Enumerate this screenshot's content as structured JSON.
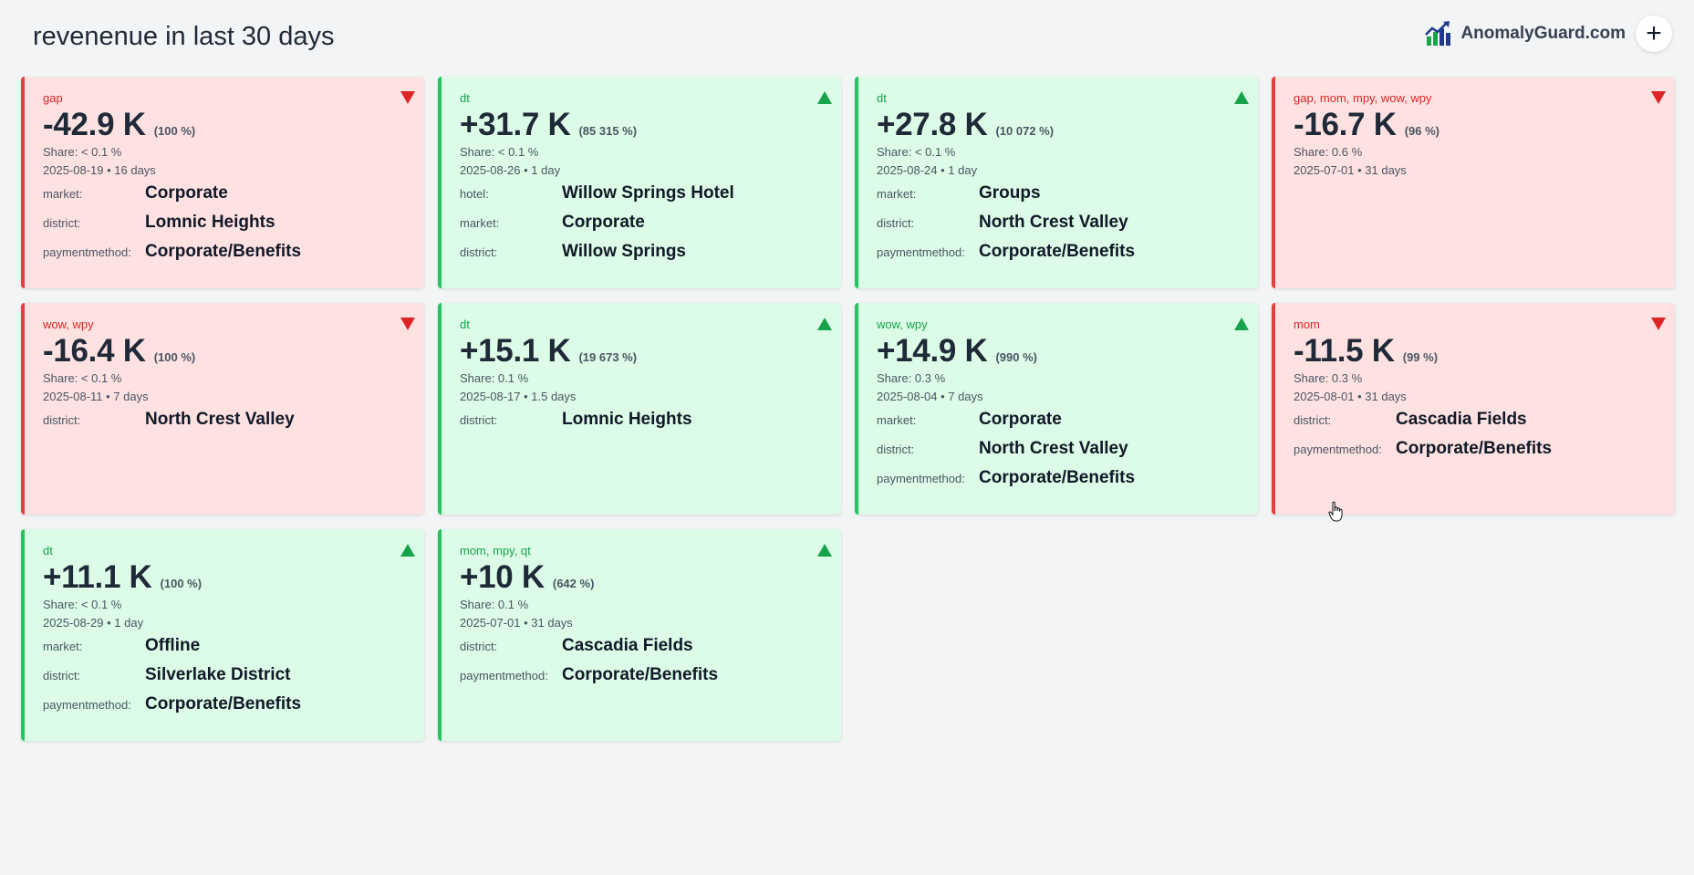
{
  "header": {
    "title": "revenenue in last 30 days",
    "brand": "AnomalyGuard.com",
    "add_label": "+"
  },
  "cards": [
    {
      "dir": "down",
      "tags": "gap",
      "value": "-42.9 K",
      "pct": "(100 %)",
      "share": "Share: < 0.1 %",
      "date": "2025-08-19 • 16 days",
      "dims": [
        {
          "k": "market:",
          "v": "Corporate"
        },
        {
          "k": "district:",
          "v": "Lomnic Heights"
        },
        {
          "k": "paymentmethod:",
          "v": "Corporate/Benefits"
        }
      ]
    },
    {
      "dir": "up",
      "tags": "dt",
      "value": "+31.7 K",
      "pct": "(85 315 %)",
      "share": "Share: < 0.1 %",
      "date": "2025-08-26 • 1 day",
      "dims": [
        {
          "k": "hotel:",
          "v": "Willow Springs Hotel"
        },
        {
          "k": "market:",
          "v": "Corporate"
        },
        {
          "k": "district:",
          "v": "Willow Springs"
        }
      ]
    },
    {
      "dir": "up",
      "tags": "dt",
      "value": "+27.8 K",
      "pct": "(10 072 %)",
      "share": "Share: < 0.1 %",
      "date": "2025-08-24 • 1 day",
      "dims": [
        {
          "k": "market:",
          "v": "Groups"
        },
        {
          "k": "district:",
          "v": "North Crest Valley"
        },
        {
          "k": "paymentmethod:",
          "v": "Corporate/Benefits"
        }
      ]
    },
    {
      "dir": "down",
      "tags": "gap, mom, mpy, wow, wpy",
      "value": "-16.7 K",
      "pct": "(96 %)",
      "share": "Share: 0.6 %",
      "date": "2025-07-01 • 31 days",
      "dims": []
    },
    {
      "dir": "down",
      "tags": "wow, wpy",
      "value": "-16.4 K",
      "pct": "(100 %)",
      "share": "Share: < 0.1 %",
      "date": "2025-08-11 • 7 days",
      "dims": [
        {
          "k": "district:",
          "v": "North Crest Valley"
        }
      ]
    },
    {
      "dir": "up",
      "tags": "dt",
      "value": "+15.1 K",
      "pct": "(19 673 %)",
      "share": "Share: 0.1 %",
      "date": "2025-08-17 • 1.5 days",
      "dims": [
        {
          "k": "district:",
          "v": "Lomnic Heights"
        }
      ]
    },
    {
      "dir": "up",
      "tags": "wow, wpy",
      "value": "+14.9 K",
      "pct": "(990 %)",
      "share": "Share: 0.3 %",
      "date": "2025-08-04 • 7 days",
      "dims": [
        {
          "k": "market:",
          "v": "Corporate"
        },
        {
          "k": "district:",
          "v": "North Crest Valley"
        },
        {
          "k": "paymentmethod:",
          "v": "Corporate/Benefits"
        }
      ]
    },
    {
      "dir": "down",
      "tags": "mom",
      "value": "-11.5 K",
      "pct": "(99 %)",
      "share": "Share: 0.3 %",
      "date": "2025-08-01 • 31 days",
      "dims": [
        {
          "k": "district:",
          "v": "Cascadia Fields"
        },
        {
          "k": "paymentmethod:",
          "v": "Corporate/Benefits"
        }
      ]
    },
    {
      "dir": "up",
      "tags": "dt",
      "value": "+11.1 K",
      "pct": "(100 %)",
      "share": "Share: < 0.1 %",
      "date": "2025-08-29 • 1 day",
      "dims": [
        {
          "k": "market:",
          "v": "Offline"
        },
        {
          "k": "district:",
          "v": "Silverlake District"
        },
        {
          "k": "paymentmethod:",
          "v": "Corporate/Benefits"
        }
      ]
    },
    {
      "dir": "up",
      "tags": "mom, mpy, qt",
      "value": "+10 K",
      "pct": "(642 %)",
      "share": "Share: 0.1 %",
      "date": "2025-07-01 • 31 days",
      "dims": [
        {
          "k": "district:",
          "v": "Cascadia Fields"
        },
        {
          "k": "paymentmethod:",
          "v": "Corporate/Benefits"
        }
      ]
    }
  ],
  "colors": {
    "down_bg": "#fee2e2",
    "down_accent": "#dc2626",
    "up_bg": "#dcfce7",
    "up_accent": "#16a34a"
  },
  "icons": {
    "brand": "bar-chart-trend-icon",
    "trend_down": "triangle-down-icon",
    "trend_up": "triangle-up-icon",
    "cursor": "hand-pointer-icon"
  }
}
